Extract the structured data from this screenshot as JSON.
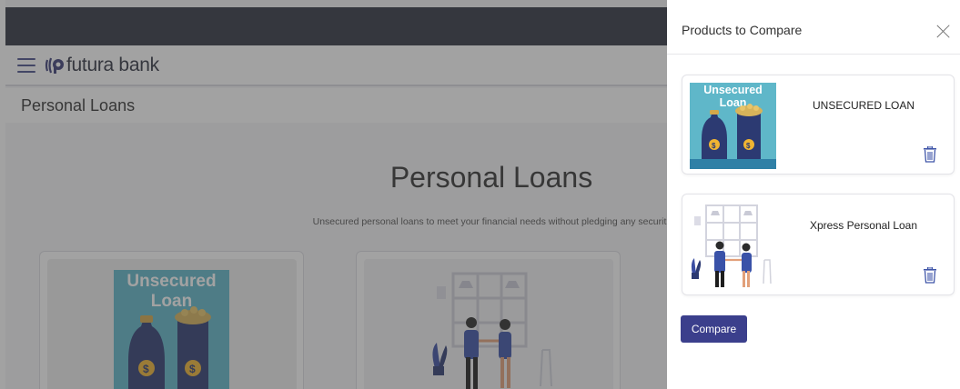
{
  "app": {
    "brand": "futura bank"
  },
  "page": {
    "breadcrumb_title": "Personal Loans",
    "hero_title": "Personal Loans",
    "hero_subtitle": "Unsecured personal loans to meet your financial needs without pledging any securit"
  },
  "cards": [
    {
      "image_text": "Unsecured Loan"
    },
    {
      "image_text": ""
    }
  ],
  "compare_panel": {
    "title": "Products to Compare",
    "products": [
      {
        "name": "UNSECURED LOAN",
        "image_text": "Unsecured Loan"
      },
      {
        "name": "Xpress Personal Loan"
      }
    ],
    "compare_label": "Compare"
  },
  "colors": {
    "topbar": "#2f3240",
    "accent": "#3b3f8c",
    "icon": "#3f55a8",
    "loan_image_bg": "#5fb7c9"
  },
  "icons": {
    "menu": "hamburger-icon",
    "logo": "futura-logo-icon",
    "close": "close-icon",
    "delete": "trash-icon"
  }
}
